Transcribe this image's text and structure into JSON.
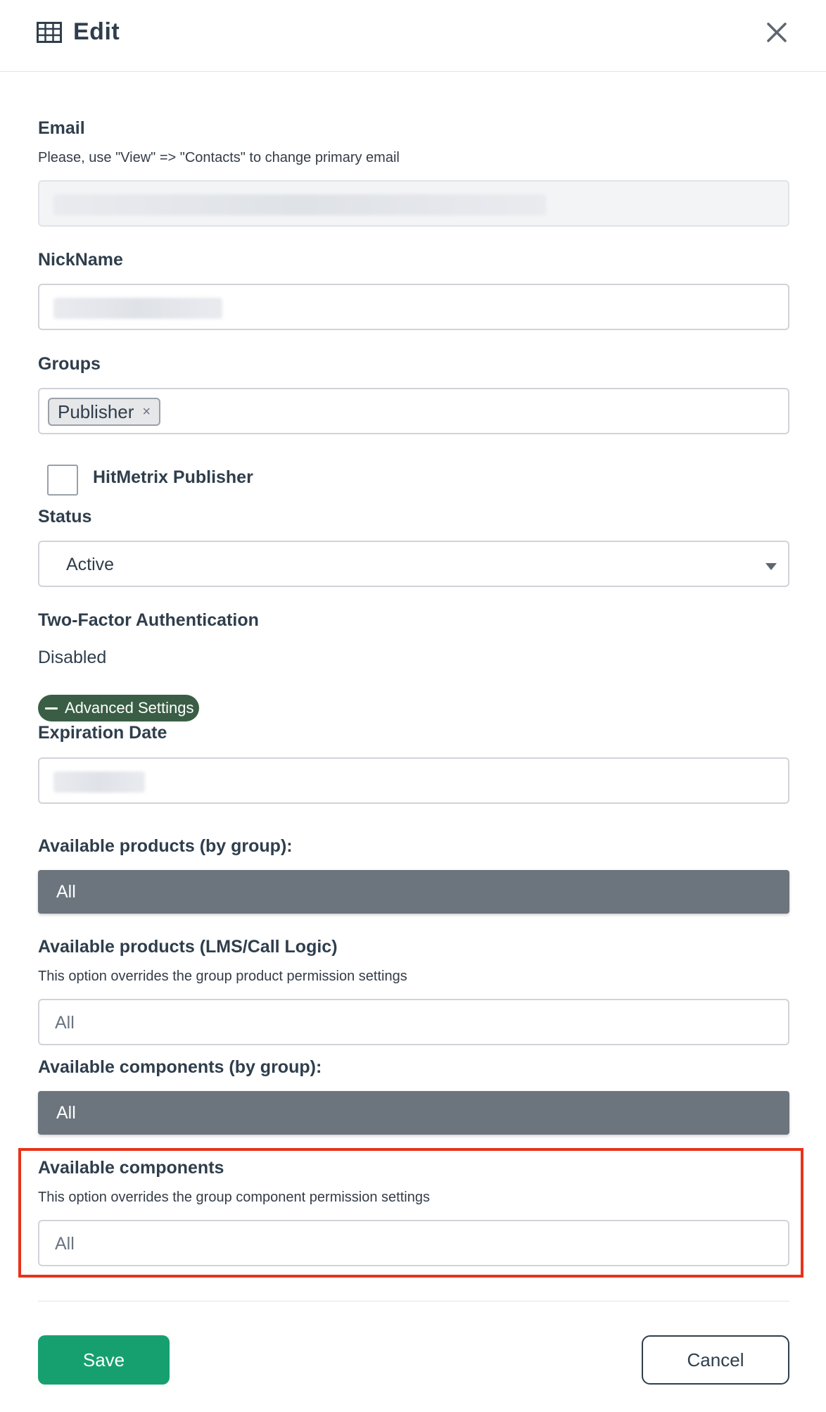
{
  "header": {
    "title": "Edit",
    "icon": "table-icon",
    "close_icon": "close-icon"
  },
  "email": {
    "label": "Email",
    "hint": "Please, use \"View\" => \"Contacts\" to change primary email",
    "value_redacted": true
  },
  "nickname": {
    "label": "NickName",
    "value_redacted": true
  },
  "groups": {
    "label": "Groups",
    "tags": [
      {
        "label": "Publisher",
        "remove_symbol": "×"
      }
    ]
  },
  "hitmetrix": {
    "label": "HitMetrix Publisher",
    "checked": false
  },
  "status": {
    "label": "Status",
    "value": "Active"
  },
  "two_factor": {
    "label": "Two-Factor Authentication",
    "value": "Disabled"
  },
  "advanced": {
    "label": "Advanced Settings",
    "expanded": true
  },
  "expiration": {
    "label": "Expiration Date",
    "value_redacted": true
  },
  "products_by_group": {
    "label": "Available products (by group):",
    "value": "All"
  },
  "products_lms": {
    "label": "Available products (LMS/Call Logic)",
    "hint": "This option overrides the group product permission settings",
    "placeholder": "All"
  },
  "components_by_group": {
    "label": "Available components (by group):",
    "value": "All"
  },
  "components": {
    "label": "Available components",
    "hint": "This option overrides the group component permission settings",
    "placeholder": "All"
  },
  "actions": {
    "save": "Save",
    "cancel": "Cancel"
  },
  "colors": {
    "text": "#2f3e4c",
    "save": "#17a06f",
    "pill": "#3a5e45",
    "grey_box": "#6c757d",
    "highlight": "#e8321a"
  }
}
